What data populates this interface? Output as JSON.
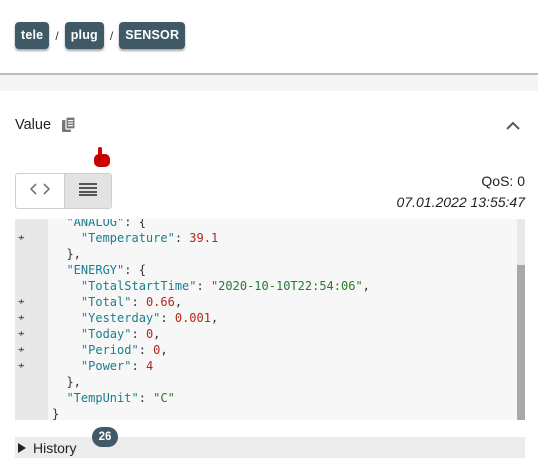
{
  "breadcrumb": {
    "parts": [
      "tele",
      "plug",
      "SENSOR"
    ],
    "separator": "/"
  },
  "value_panel": {
    "title": "Value",
    "qos": "QoS: 0",
    "timestamp": "07.01.2022 13:55:47"
  },
  "icons": {
    "copy": "copy-icon",
    "collapse": "chevron-up-icon",
    "code_view": "code-icon",
    "raw_view": "lines-icon",
    "pointer": "pointing-hand-icon",
    "gutter_marker": "tilde"
  },
  "json_lines": [
    {
      "indent": "  ",
      "parts": [
        [
          "k",
          "\"ANALOG\""
        ],
        [
          "p",
          ": {"
        ]
      ],
      "marker": ""
    },
    {
      "indent": "    ",
      "parts": [
        [
          "k",
          "\"Temperature\""
        ],
        [
          "p",
          ": "
        ],
        [
          "n",
          "39.1"
        ]
      ],
      "marker": "≁"
    },
    {
      "indent": "  ",
      "parts": [
        [
          "p",
          "},"
        ]
      ],
      "marker": ""
    },
    {
      "indent": "  ",
      "parts": [
        [
          "k",
          "\"ENERGY\""
        ],
        [
          "p",
          ": {"
        ]
      ],
      "marker": ""
    },
    {
      "indent": "    ",
      "parts": [
        [
          "k",
          "\"TotalStartTime\""
        ],
        [
          "p",
          ": "
        ],
        [
          "s",
          "\"2020-10-10T22:54:06\""
        ],
        [
          "p",
          ","
        ]
      ],
      "marker": ""
    },
    {
      "indent": "    ",
      "parts": [
        [
          "k",
          "\"Total\""
        ],
        [
          "p",
          ": "
        ],
        [
          "n",
          "0.66"
        ],
        [
          "p",
          ","
        ]
      ],
      "marker": "≁"
    },
    {
      "indent": "    ",
      "parts": [
        [
          "k",
          "\"Yesterday\""
        ],
        [
          "p",
          ": "
        ],
        [
          "n",
          "0.001"
        ],
        [
          "p",
          ","
        ]
      ],
      "marker": "≁"
    },
    {
      "indent": "    ",
      "parts": [
        [
          "k",
          "\"Today\""
        ],
        [
          "p",
          ": "
        ],
        [
          "n",
          "0"
        ],
        [
          "p",
          ","
        ]
      ],
      "marker": "≁"
    },
    {
      "indent": "    ",
      "parts": [
        [
          "k",
          "\"Period\""
        ],
        [
          "p",
          ": "
        ],
        [
          "n",
          "0"
        ],
        [
          "p",
          ","
        ]
      ],
      "marker": "≁"
    },
    {
      "indent": "    ",
      "parts": [
        [
          "k",
          "\"Power\""
        ],
        [
          "p",
          ": "
        ],
        [
          "n",
          "4"
        ]
      ],
      "marker": "≁"
    },
    {
      "indent": "  ",
      "parts": [
        [
          "p",
          "},"
        ]
      ],
      "marker": ""
    },
    {
      "indent": "  ",
      "parts": [
        [
          "k",
          "\"TempUnit\""
        ],
        [
          "p",
          ": "
        ],
        [
          "s",
          "\"C\""
        ]
      ],
      "marker": ""
    },
    {
      "indent": "",
      "parts": [
        [
          "p",
          "}"
        ]
      ],
      "marker": ""
    }
  ],
  "history": {
    "label": "History",
    "count": "26"
  },
  "colors": {
    "chip": "#3f5a66",
    "key": "#1a7f8e",
    "string": "#2a7a2a",
    "number": "#b3261e",
    "pointer": "#cc0000"
  }
}
